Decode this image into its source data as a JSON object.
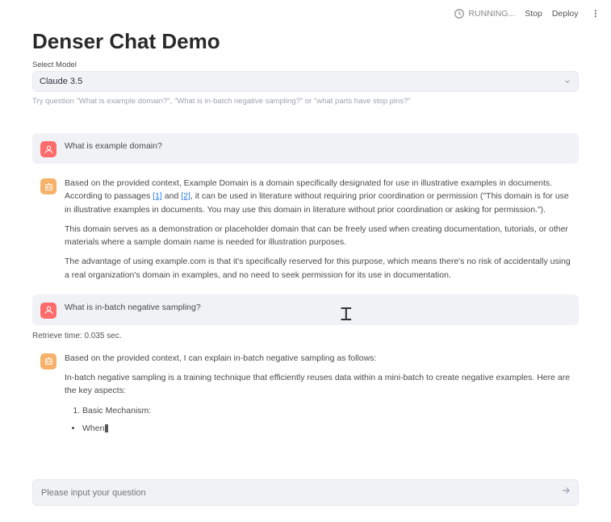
{
  "topbar": {
    "running_label": "RUNNING...",
    "stop_label": "Stop",
    "deploy_label": "Deploy"
  },
  "title": "Denser Chat Demo",
  "select": {
    "label": "Select Model",
    "value": "Claude 3.5"
  },
  "hint": "Try question \"What is example domain?\", \"What is in-batch negative sampling?\" or \"what parts have stop pins?\"",
  "messages": {
    "q1": "What is example domain?",
    "a1_p1_pre": "Based on the provided context, Example Domain is a domain specifically designated for use in illustrative examples in documents. According to passages ",
    "a1_c1": "[1]",
    "a1_mid": " and ",
    "a1_c2": "[2]",
    "a1_p1_post": ", it can be used in literature without requiring prior coordination or permission (\"This domain is for use in illustrative examples in documents. You may use this domain in literature without prior coordination or asking for permission.\").",
    "a1_p2": "This domain serves as a demonstration or placeholder domain that can be freely used when creating documentation, tutorials, or other materials where a sample domain name is needed for illustration purposes.",
    "a1_p3": "The advantage of using example.com is that it's specifically reserved for this purpose, which means there's no risk of accidentally using a real organization's domain in examples, and no need to seek permission for its use in documentation.",
    "q2": "What is in-batch negative sampling?",
    "retrieve": "Retrieve time: 0.035 sec.",
    "a2_p1": "Based on the provided context, I can explain in-batch negative sampling as follows:",
    "a2_p2": "In-batch negative sampling is a training technique that efficiently reuses data within a mini-batch to create negative examples. Here are the key aspects:",
    "a2_ol1": "Basic Mechanism:",
    "a2_ul1": "When"
  },
  "input": {
    "placeholder": "Please input your question"
  }
}
